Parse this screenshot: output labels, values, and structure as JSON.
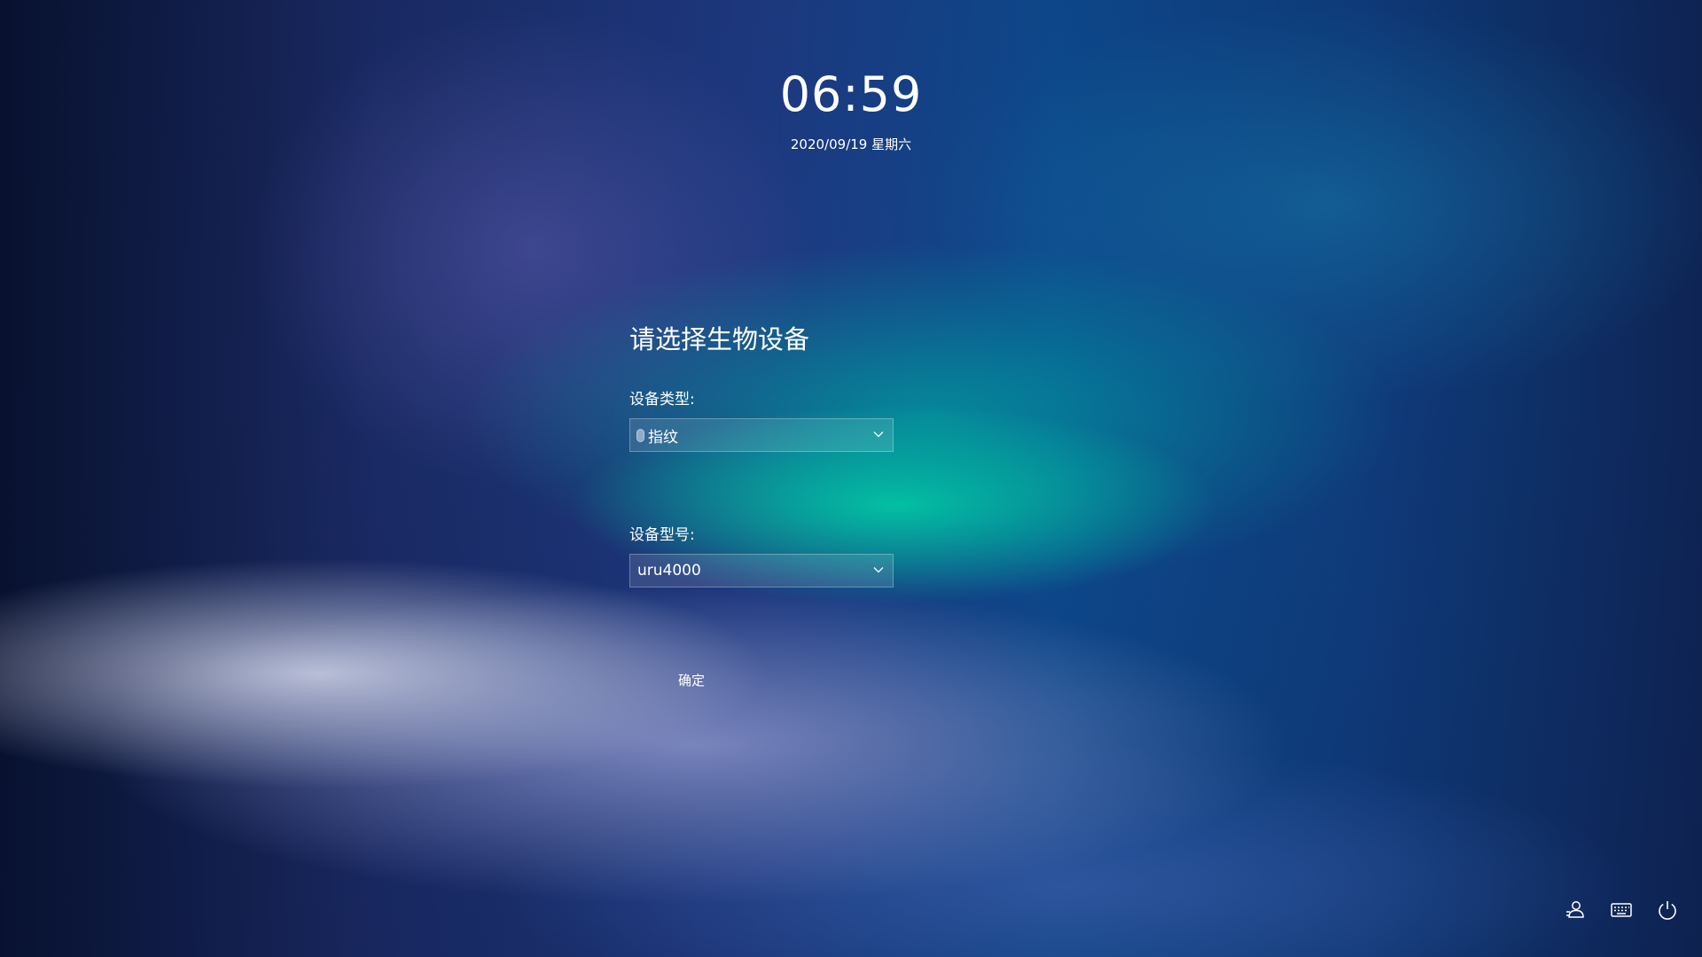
{
  "clock": {
    "time": "06:59",
    "date": "2020/09/19 星期六"
  },
  "biometric": {
    "title": "请选择生物设备",
    "device_type_label": "设备类型:",
    "device_type_value": "指纹",
    "device_type_icon": "fingerprint-icon",
    "device_model_label": "设备型号:",
    "device_model_value": "uru4000",
    "confirm_label": "确定"
  },
  "tray": {
    "items": [
      "switch-user-icon",
      "keyboard-icon",
      "power-icon"
    ]
  }
}
